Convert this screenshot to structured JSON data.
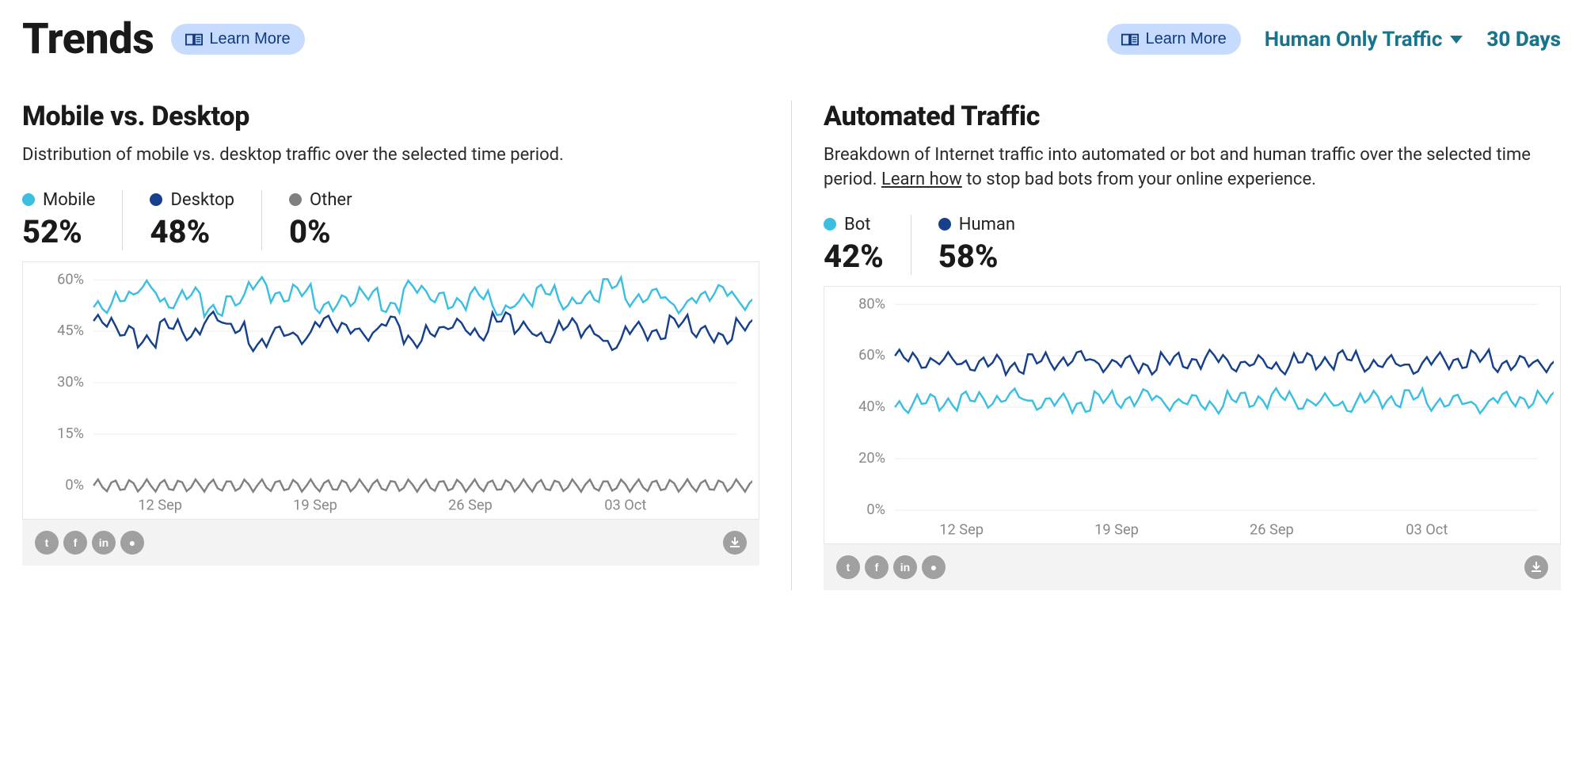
{
  "header": {
    "title": "Trends",
    "learn_more": "Learn More",
    "learn_more_2": "Learn More",
    "traffic_filter_label": "Human Only Traffic",
    "range_label": "30 Days"
  },
  "colors": {
    "light_blue": "#3bbfe1",
    "dark_blue": "#163f8c",
    "gray": "#808080"
  },
  "panels": {
    "mobile_desktop": {
      "title": "Mobile vs. Desktop",
      "desc": "Distribution of mobile vs. desktop traffic over the selected time period.",
      "legend": [
        {
          "label": "Mobile",
          "value": "52%",
          "color": "#3bbfe1"
        },
        {
          "label": "Desktop",
          "value": "48%",
          "color": "#163f8c"
        },
        {
          "label": "Other",
          "value": "0%",
          "color": "#808080"
        }
      ]
    },
    "automated": {
      "title": "Automated Traffic",
      "desc_prefix": "Breakdown of Internet traffic into automated or bot and human traffic over the selected time period. ",
      "desc_link": "Learn how",
      "desc_suffix": " to stop bad bots from your online experience.",
      "legend": [
        {
          "label": "Bot",
          "value": "42%",
          "color": "#3bbfe1"
        },
        {
          "label": "Human",
          "value": "58%",
          "color": "#163f8c"
        }
      ]
    }
  },
  "chart_data": [
    {
      "id": "mobile_desktop",
      "type": "line",
      "title": "Mobile vs. Desktop",
      "xlabel": "",
      "ylabel": "",
      "ylim": [
        0,
        60
      ],
      "y_ticks": [
        0,
        15,
        30,
        45,
        60
      ],
      "y_tick_labels": [
        "0%",
        "15%",
        "30%",
        "45%",
        "60%"
      ],
      "x_tick_labels": [
        "12 Sep",
        "19 Sep",
        "26 Sep",
        "03 Oct"
      ],
      "x": [
        0,
        1,
        2,
        3,
        4,
        5,
        6,
        7,
        8,
        9,
        10,
        11,
        12,
        13,
        14,
        15,
        16,
        17,
        18,
        19,
        20,
        21,
        22,
        23,
        24,
        25,
        26,
        27,
        28,
        29
      ],
      "series": [
        {
          "name": "Mobile",
          "color": "#3bbfe1",
          "values": [
            52,
            55,
            58,
            53,
            56,
            51,
            54,
            59,
            55,
            57,
            52,
            54,
            56,
            52,
            58,
            55,
            53,
            56,
            51,
            54,
            57,
            53,
            55,
            59,
            54,
            56,
            52,
            55,
            57,
            53
          ]
        },
        {
          "name": "Desktop",
          "color": "#163f8c",
          "values": [
            48,
            45,
            42,
            47,
            44,
            49,
            46,
            41,
            45,
            43,
            48,
            46,
            44,
            48,
            42,
            45,
            47,
            44,
            49,
            46,
            43,
            47,
            45,
            41,
            46,
            44,
            48,
            45,
            43,
            47
          ]
        },
        {
          "name": "Other",
          "color": "#808080",
          "values": [
            0,
            0,
            0,
            0,
            0,
            0,
            0,
            0,
            0,
            0,
            0,
            0,
            0,
            0,
            0,
            0,
            0,
            0,
            0,
            0,
            0,
            0,
            0,
            0,
            0,
            0,
            0,
            0,
            0,
            0
          ]
        }
      ]
    },
    {
      "id": "automated",
      "type": "line",
      "title": "Automated Traffic",
      "xlabel": "",
      "ylabel": "",
      "ylim": [
        0,
        80
      ],
      "y_ticks": [
        0,
        20,
        40,
        60,
        80
      ],
      "y_tick_labels": [
        "0%",
        "20%",
        "40%",
        "60%",
        "80%"
      ],
      "x_tick_labels": [
        "12 Sep",
        "19 Sep",
        "26 Sep",
        "03 Oct"
      ],
      "x": [
        0,
        1,
        2,
        3,
        4,
        5,
        6,
        7,
        8,
        9,
        10,
        11,
        12,
        13,
        14,
        15,
        16,
        17,
        18,
        19,
        20,
        21,
        22,
        23,
        24,
        25,
        26,
        27,
        28,
        29
      ],
      "series": [
        {
          "name": "Bot",
          "color": "#3bbfe1",
          "values": [
            40,
            43,
            41,
            44,
            42,
            45,
            41,
            43,
            40,
            44,
            42,
            45,
            41,
            43,
            40,
            44,
            42,
            45,
            41,
            43,
            40,
            44,
            42,
            45,
            41,
            43,
            40,
            44,
            42,
            44
          ]
        },
        {
          "name": "Human",
          "color": "#163f8c",
          "values": [
            60,
            57,
            59,
            56,
            58,
            55,
            59,
            57,
            60,
            56,
            58,
            55,
            59,
            57,
            60,
            56,
            58,
            55,
            59,
            57,
            60,
            56,
            58,
            55,
            59,
            57,
            60,
            56,
            58,
            56
          ]
        }
      ]
    }
  ]
}
